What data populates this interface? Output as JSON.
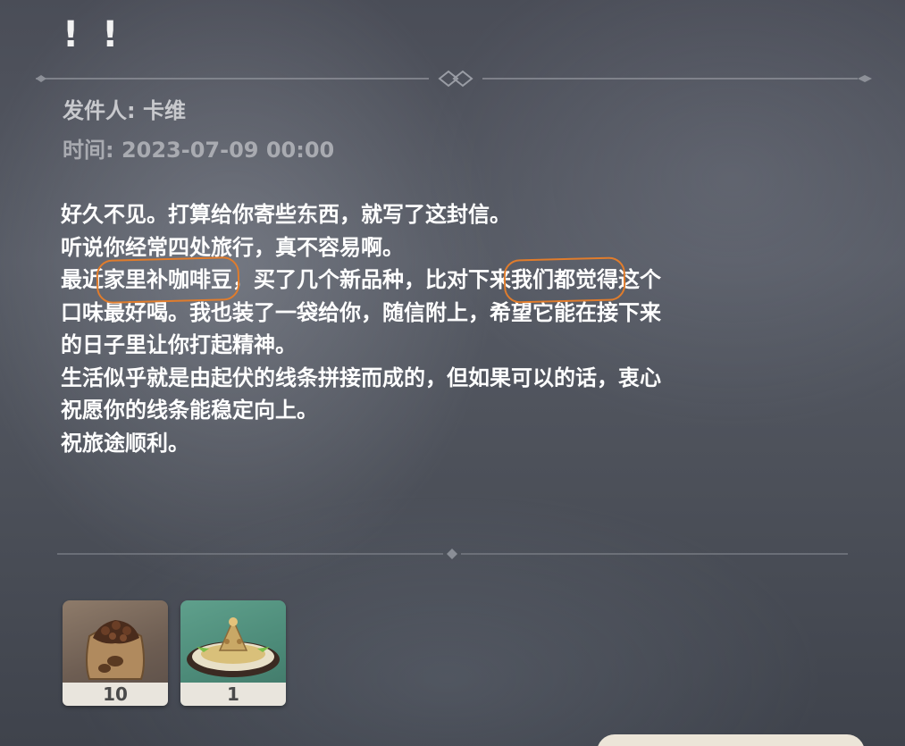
{
  "mail": {
    "title": "! !",
    "sender_label": "发件人: ",
    "sender_name": "卡维",
    "time_label": "时间: ",
    "time_value": "2023-07-09 00:00",
    "body": {
      "line1": "好久不见。打算给你寄些东西，就写了这封信。",
      "line2": "听说你经常四处旅行，真不容易啊。",
      "line3_pre": "最近",
      "line3_hl1": "家里补咖啡豆",
      "line3_mid": "，买了几个新品种，比对下来",
      "line3_hl2": "我们都觉得",
      "line3_post": "这个",
      "line4": "口味最好喝。我也装了一袋给你，随信附上，希望它能在接下来",
      "line5": "的日子里让你打起精神。",
      "line6": "生活似乎就是由起伏的线条拼接而成的，但如果可以的话，衷心",
      "line7": "祝愿你的线条能稳定向上。",
      "line8": "祝旅途顺利。"
    }
  },
  "attachments": [
    {
      "icon": "coffee-bean-sack-icon",
      "count": "10"
    },
    {
      "icon": "food-dish-icon",
      "count": "1"
    }
  ],
  "colors": {
    "highlight": "#e07c2c",
    "text": "#ffffff",
    "meta": "#c8c9cd"
  }
}
